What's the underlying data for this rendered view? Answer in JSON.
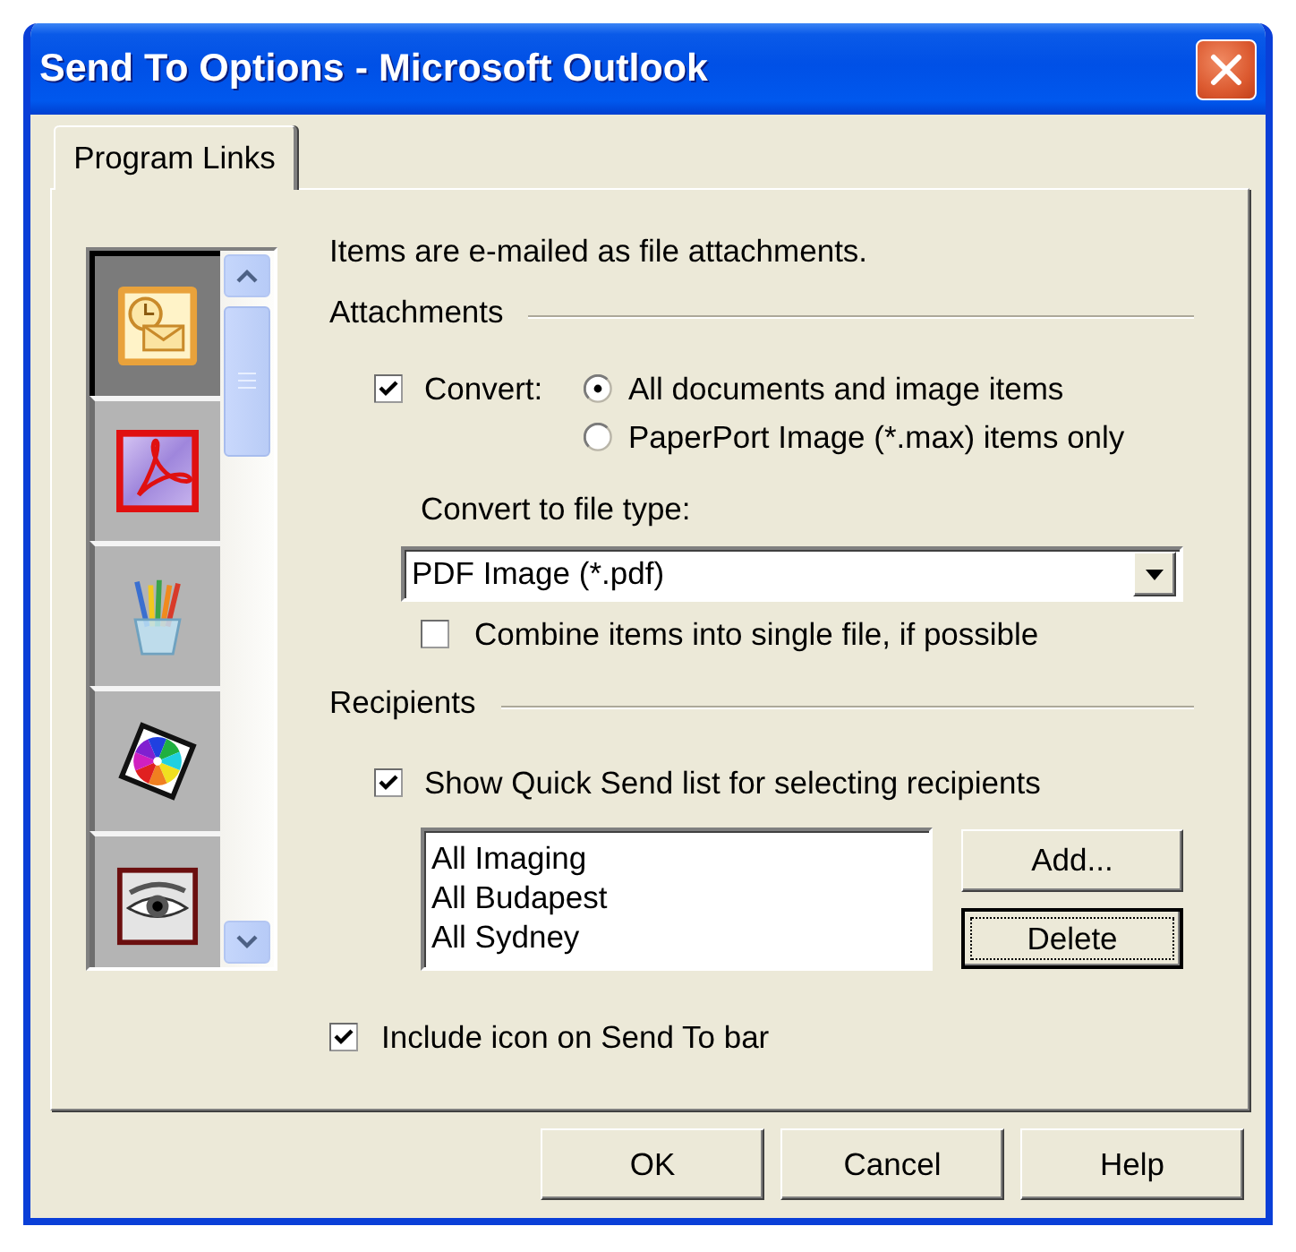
{
  "window": {
    "title": "Send To Options - Microsoft Outlook"
  },
  "tabs": [
    {
      "label": "Program Links",
      "selected": true
    }
  ],
  "program_list": {
    "items": [
      {
        "kind": "clock_envelope",
        "selected": true
      },
      {
        "kind": "frame_symbol",
        "selected": false
      },
      {
        "kind": "brushes",
        "selected": false
      },
      {
        "kind": "color_wheel",
        "selected": false
      },
      {
        "kind": "eye",
        "selected": false
      }
    ]
  },
  "description": "Items are e-mailed as file attachments.",
  "attachments": {
    "heading": "Attachments",
    "convert": {
      "label": "Convert:",
      "checked": true
    },
    "convert_options": [
      {
        "label": "All documents and image items",
        "selected": true
      },
      {
        "label": "PaperPort Image (*.max) items only",
        "selected": false
      }
    ],
    "file_type": {
      "label": "Convert to file type:",
      "value": "PDF Image (*.pdf)"
    },
    "combine": {
      "label": "Combine items into single file, if possible",
      "checked": false
    }
  },
  "recipients": {
    "heading": "Recipients",
    "show_quick_send": {
      "label": "Show Quick Send list for selecting recipients",
      "checked": true
    },
    "list": [
      "All Imaging",
      "All Budapest",
      "All Sydney"
    ],
    "buttons": [
      {
        "label": "Add...",
        "focused": false
      },
      {
        "label": "Delete",
        "focused": true
      }
    ]
  },
  "include_icon": {
    "label": "Include icon on Send To bar",
    "checked": true
  },
  "buttons": [
    {
      "label": "OK"
    },
    {
      "label": "Cancel"
    },
    {
      "label": "Help"
    }
  ]
}
